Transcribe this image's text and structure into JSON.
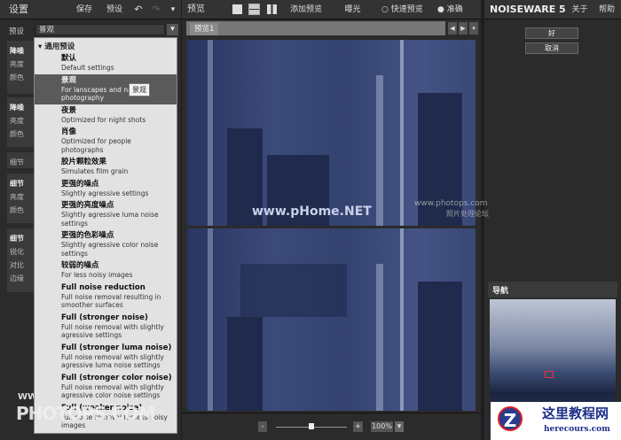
{
  "left": {
    "title": "设置",
    "save": "保存",
    "presets": "预设",
    "preset_label": "预设",
    "preset_value": "景观",
    "sections": [
      {
        "title": "降噪",
        "rows": [
          "亮度",
          "颜色"
        ]
      },
      {
        "title": "降噪",
        "rows": [
          "亮度",
          "颜色"
        ]
      },
      {
        "title": "细节",
        "rows": []
      },
      {
        "title": "细节",
        "rows": [
          "亮度",
          "颜色"
        ]
      },
      {
        "title": "细节",
        "rows": [
          "锐化",
          "对比",
          "边缘"
        ]
      }
    ]
  },
  "menu": {
    "group": "通用预设",
    "tooltip": "景观",
    "items": [
      {
        "t": "默认",
        "d": "Default settings"
      },
      {
        "t": "景观",
        "d": "For lanscapes and nature photography"
      },
      {
        "t": "夜景",
        "d": "Optimized for night shots"
      },
      {
        "t": "肖像",
        "d": "Optimized for people photographs"
      },
      {
        "t": "胶片颗粒效果",
        "d": "Simulates film grain"
      },
      {
        "t": "更强的噪点",
        "d": "Slightly agressive settings"
      },
      {
        "t": "更强的亮度噪点",
        "d": "Slightly agressive luma noise settings"
      },
      {
        "t": "更强的色彩噪点",
        "d": "Slightly agressive color noise settings"
      },
      {
        "t": "较弱的噪点",
        "d": "For less noisy images"
      },
      {
        "t": "Full noise reduction",
        "d": "Full noise removal resulting in smoother surfaces"
      },
      {
        "t": "Full (stronger noise)",
        "d": "Full noise removal with slightly agressive settings"
      },
      {
        "t": "Full (stronger luma noise)",
        "d": "Full noise removal with slightly agressive luma noise settings"
      },
      {
        "t": "Full (stronger color noise)",
        "d": "Full noise removal with slightly agressive color noise settings"
      },
      {
        "t": "Full (weaker noise)",
        "d": "Full noise removal for less noisy images"
      }
    ]
  },
  "center": {
    "title": "预览",
    "add_preview": "添加预览",
    "exposure": "曝光",
    "fast_preview": "快速预览",
    "accurate": "准确",
    "tab": "预览1",
    "zoom": "100%",
    "minus": "-",
    "plus": "+"
  },
  "right": {
    "brand": "NOISEWARE 5",
    "about": "关于",
    "help": "帮助",
    "ok": "好",
    "cancel": "取消",
    "navigator": "导航"
  },
  "watermarks": {
    "phome": "www.pHome.NET",
    "photops": "www.photops.com",
    "photops_cn": "照片处理论坛",
    "left": "WWW.",
    "left_big": "PHOTOPS.COM",
    "logo_cn": "这里教程网",
    "logo_en": "herecours.com"
  }
}
